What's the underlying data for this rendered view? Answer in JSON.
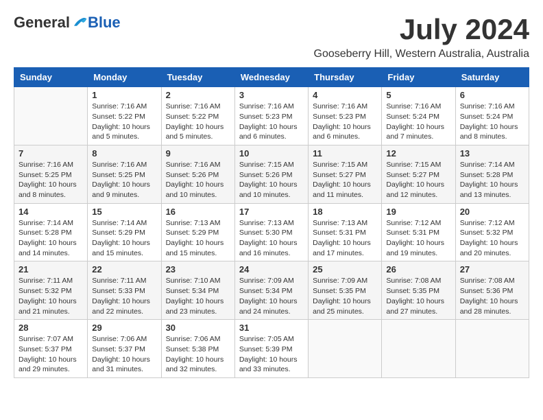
{
  "logo": {
    "general": "General",
    "blue": "Blue"
  },
  "title": "July 2024",
  "location": "Gooseberry Hill, Western Australia, Australia",
  "days_header": [
    "Sunday",
    "Monday",
    "Tuesday",
    "Wednesday",
    "Thursday",
    "Friday",
    "Saturday"
  ],
  "weeks": [
    [
      {
        "day": "",
        "info": ""
      },
      {
        "day": "1",
        "info": "Sunrise: 7:16 AM\nSunset: 5:22 PM\nDaylight: 10 hours\nand 5 minutes."
      },
      {
        "day": "2",
        "info": "Sunrise: 7:16 AM\nSunset: 5:22 PM\nDaylight: 10 hours\nand 5 minutes."
      },
      {
        "day": "3",
        "info": "Sunrise: 7:16 AM\nSunset: 5:23 PM\nDaylight: 10 hours\nand 6 minutes."
      },
      {
        "day": "4",
        "info": "Sunrise: 7:16 AM\nSunset: 5:23 PM\nDaylight: 10 hours\nand 6 minutes."
      },
      {
        "day": "5",
        "info": "Sunrise: 7:16 AM\nSunset: 5:24 PM\nDaylight: 10 hours\nand 7 minutes."
      },
      {
        "day": "6",
        "info": "Sunrise: 7:16 AM\nSunset: 5:24 PM\nDaylight: 10 hours\nand 8 minutes."
      }
    ],
    [
      {
        "day": "7",
        "info": "Sunrise: 7:16 AM\nSunset: 5:25 PM\nDaylight: 10 hours\nand 8 minutes."
      },
      {
        "day": "8",
        "info": "Sunrise: 7:16 AM\nSunset: 5:25 PM\nDaylight: 10 hours\nand 9 minutes."
      },
      {
        "day": "9",
        "info": "Sunrise: 7:16 AM\nSunset: 5:26 PM\nDaylight: 10 hours\nand 10 minutes."
      },
      {
        "day": "10",
        "info": "Sunrise: 7:15 AM\nSunset: 5:26 PM\nDaylight: 10 hours\nand 10 minutes."
      },
      {
        "day": "11",
        "info": "Sunrise: 7:15 AM\nSunset: 5:27 PM\nDaylight: 10 hours\nand 11 minutes."
      },
      {
        "day": "12",
        "info": "Sunrise: 7:15 AM\nSunset: 5:27 PM\nDaylight: 10 hours\nand 12 minutes."
      },
      {
        "day": "13",
        "info": "Sunrise: 7:14 AM\nSunset: 5:28 PM\nDaylight: 10 hours\nand 13 minutes."
      }
    ],
    [
      {
        "day": "14",
        "info": "Sunrise: 7:14 AM\nSunset: 5:28 PM\nDaylight: 10 hours\nand 14 minutes."
      },
      {
        "day": "15",
        "info": "Sunrise: 7:14 AM\nSunset: 5:29 PM\nDaylight: 10 hours\nand 15 minutes."
      },
      {
        "day": "16",
        "info": "Sunrise: 7:13 AM\nSunset: 5:29 PM\nDaylight: 10 hours\nand 15 minutes."
      },
      {
        "day": "17",
        "info": "Sunrise: 7:13 AM\nSunset: 5:30 PM\nDaylight: 10 hours\nand 16 minutes."
      },
      {
        "day": "18",
        "info": "Sunrise: 7:13 AM\nSunset: 5:31 PM\nDaylight: 10 hours\nand 17 minutes."
      },
      {
        "day": "19",
        "info": "Sunrise: 7:12 AM\nSunset: 5:31 PM\nDaylight: 10 hours\nand 19 minutes."
      },
      {
        "day": "20",
        "info": "Sunrise: 7:12 AM\nSunset: 5:32 PM\nDaylight: 10 hours\nand 20 minutes."
      }
    ],
    [
      {
        "day": "21",
        "info": "Sunrise: 7:11 AM\nSunset: 5:32 PM\nDaylight: 10 hours\nand 21 minutes."
      },
      {
        "day": "22",
        "info": "Sunrise: 7:11 AM\nSunset: 5:33 PM\nDaylight: 10 hours\nand 22 minutes."
      },
      {
        "day": "23",
        "info": "Sunrise: 7:10 AM\nSunset: 5:34 PM\nDaylight: 10 hours\nand 23 minutes."
      },
      {
        "day": "24",
        "info": "Sunrise: 7:09 AM\nSunset: 5:34 PM\nDaylight: 10 hours\nand 24 minutes."
      },
      {
        "day": "25",
        "info": "Sunrise: 7:09 AM\nSunset: 5:35 PM\nDaylight: 10 hours\nand 25 minutes."
      },
      {
        "day": "26",
        "info": "Sunrise: 7:08 AM\nSunset: 5:35 PM\nDaylight: 10 hours\nand 27 minutes."
      },
      {
        "day": "27",
        "info": "Sunrise: 7:08 AM\nSunset: 5:36 PM\nDaylight: 10 hours\nand 28 minutes."
      }
    ],
    [
      {
        "day": "28",
        "info": "Sunrise: 7:07 AM\nSunset: 5:37 PM\nDaylight: 10 hours\nand 29 minutes."
      },
      {
        "day": "29",
        "info": "Sunrise: 7:06 AM\nSunset: 5:37 PM\nDaylight: 10 hours\nand 31 minutes."
      },
      {
        "day": "30",
        "info": "Sunrise: 7:06 AM\nSunset: 5:38 PM\nDaylight: 10 hours\nand 32 minutes."
      },
      {
        "day": "31",
        "info": "Sunrise: 7:05 AM\nSunset: 5:39 PM\nDaylight: 10 hours\nand 33 minutes."
      },
      {
        "day": "",
        "info": ""
      },
      {
        "day": "",
        "info": ""
      },
      {
        "day": "",
        "info": ""
      }
    ]
  ]
}
